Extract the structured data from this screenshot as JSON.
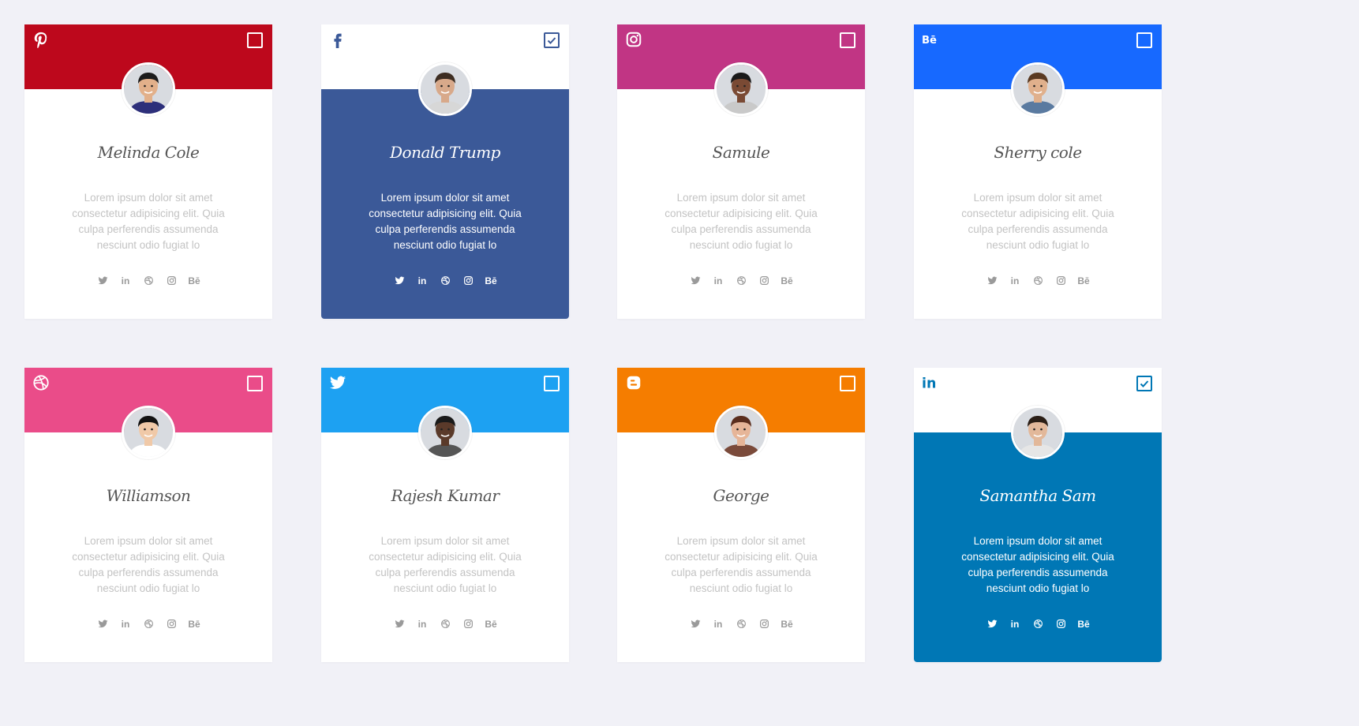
{
  "cards": [
    {
      "name": "Melinda Cole",
      "brand": "pinterest-icon",
      "color": "#bd081c",
      "selected": false,
      "desc": "Lorem ipsum dolor sit amet consectetur adipisicing elit. Quia culpa perferendis assumenda nesciunt odio fugiat lo",
      "skin": "#e2b08a",
      "hair": "#1c1c1c",
      "shirt": "#2d2f7a"
    },
    {
      "name": "Donald Trump",
      "brand": "facebook-icon",
      "color": "#3b5998",
      "selected": true,
      "desc": "Lorem ipsum dolor sit amet consectetur adipisicing elit. Quia culpa perferendis assumenda nesciunt odio fugiat lo",
      "skin": "#d8a98a",
      "hair": "#3d2d22",
      "shirt": "#d7d7d7"
    },
    {
      "name": "Samule",
      "brand": "instagram-icon",
      "color": "#c13584",
      "selected": false,
      "desc": "Lorem ipsum dolor sit amet consectetur adipisicing elit. Quia culpa perferendis assumenda nesciunt odio fugiat lo",
      "skin": "#7a4a34",
      "hair": "#1a1a1a",
      "shirt": "#c9c9c9"
    },
    {
      "name": "Sherry cole",
      "brand": "behance-icon",
      "color": "#1769ff",
      "selected": false,
      "desc": "Lorem ipsum dolor sit amet consectetur adipisicing elit. Quia culpa perferendis assumenda nesciunt odio fugiat lo",
      "skin": "#e0b08c",
      "hair": "#5a3a22",
      "shirt": "#5a7aa0"
    },
    {
      "name": "Williamson",
      "brand": "dribbble-icon",
      "color": "#ea4c89",
      "selected": false,
      "desc": "Lorem ipsum dolor sit amet consectetur adipisicing elit. Quia culpa perferendis assumenda nesciunt odio fugiat lo",
      "skin": "#f0c9a8",
      "hair": "#121212",
      "shirt": "#ffffff"
    },
    {
      "name": "Rajesh Kumar",
      "brand": "twitter-icon",
      "color": "#1da1f2",
      "selected": false,
      "desc": "Lorem ipsum dolor sit amet consectetur adipisicing elit. Quia culpa perferendis assumenda nesciunt odio fugiat lo",
      "skin": "#5a3a2a",
      "hair": "#1a1a1a",
      "shirt": "#555555"
    },
    {
      "name": "George",
      "brand": "blogger-icon",
      "color": "#f57d00",
      "selected": false,
      "desc": "Lorem ipsum dolor sit amet consectetur adipisicing elit. Quia culpa perferendis assumenda nesciunt odio fugiat lo",
      "skin": "#e6b598",
      "hair": "#5a2e1e",
      "shirt": "#7a4a3a"
    },
    {
      "name": "Samantha Sam",
      "brand": "linkedin-icon",
      "color": "#0077b5",
      "selected": true,
      "desc": "Lorem ipsum dolor sit amet consectetur adipisicing elit. Quia culpa perferendis assumenda nesciunt odio fugiat lo",
      "skin": "#e2b89a",
      "hair": "#2a1e16",
      "shirt": "#e6e6e6"
    }
  ],
  "socials": [
    {
      "icon": "twitter-icon"
    },
    {
      "icon": "linkedin-icon",
      "text": "in"
    },
    {
      "icon": "dribbble-icon"
    },
    {
      "icon": "instagram-icon"
    },
    {
      "icon": "behance-icon",
      "text": "Bē"
    }
  ]
}
